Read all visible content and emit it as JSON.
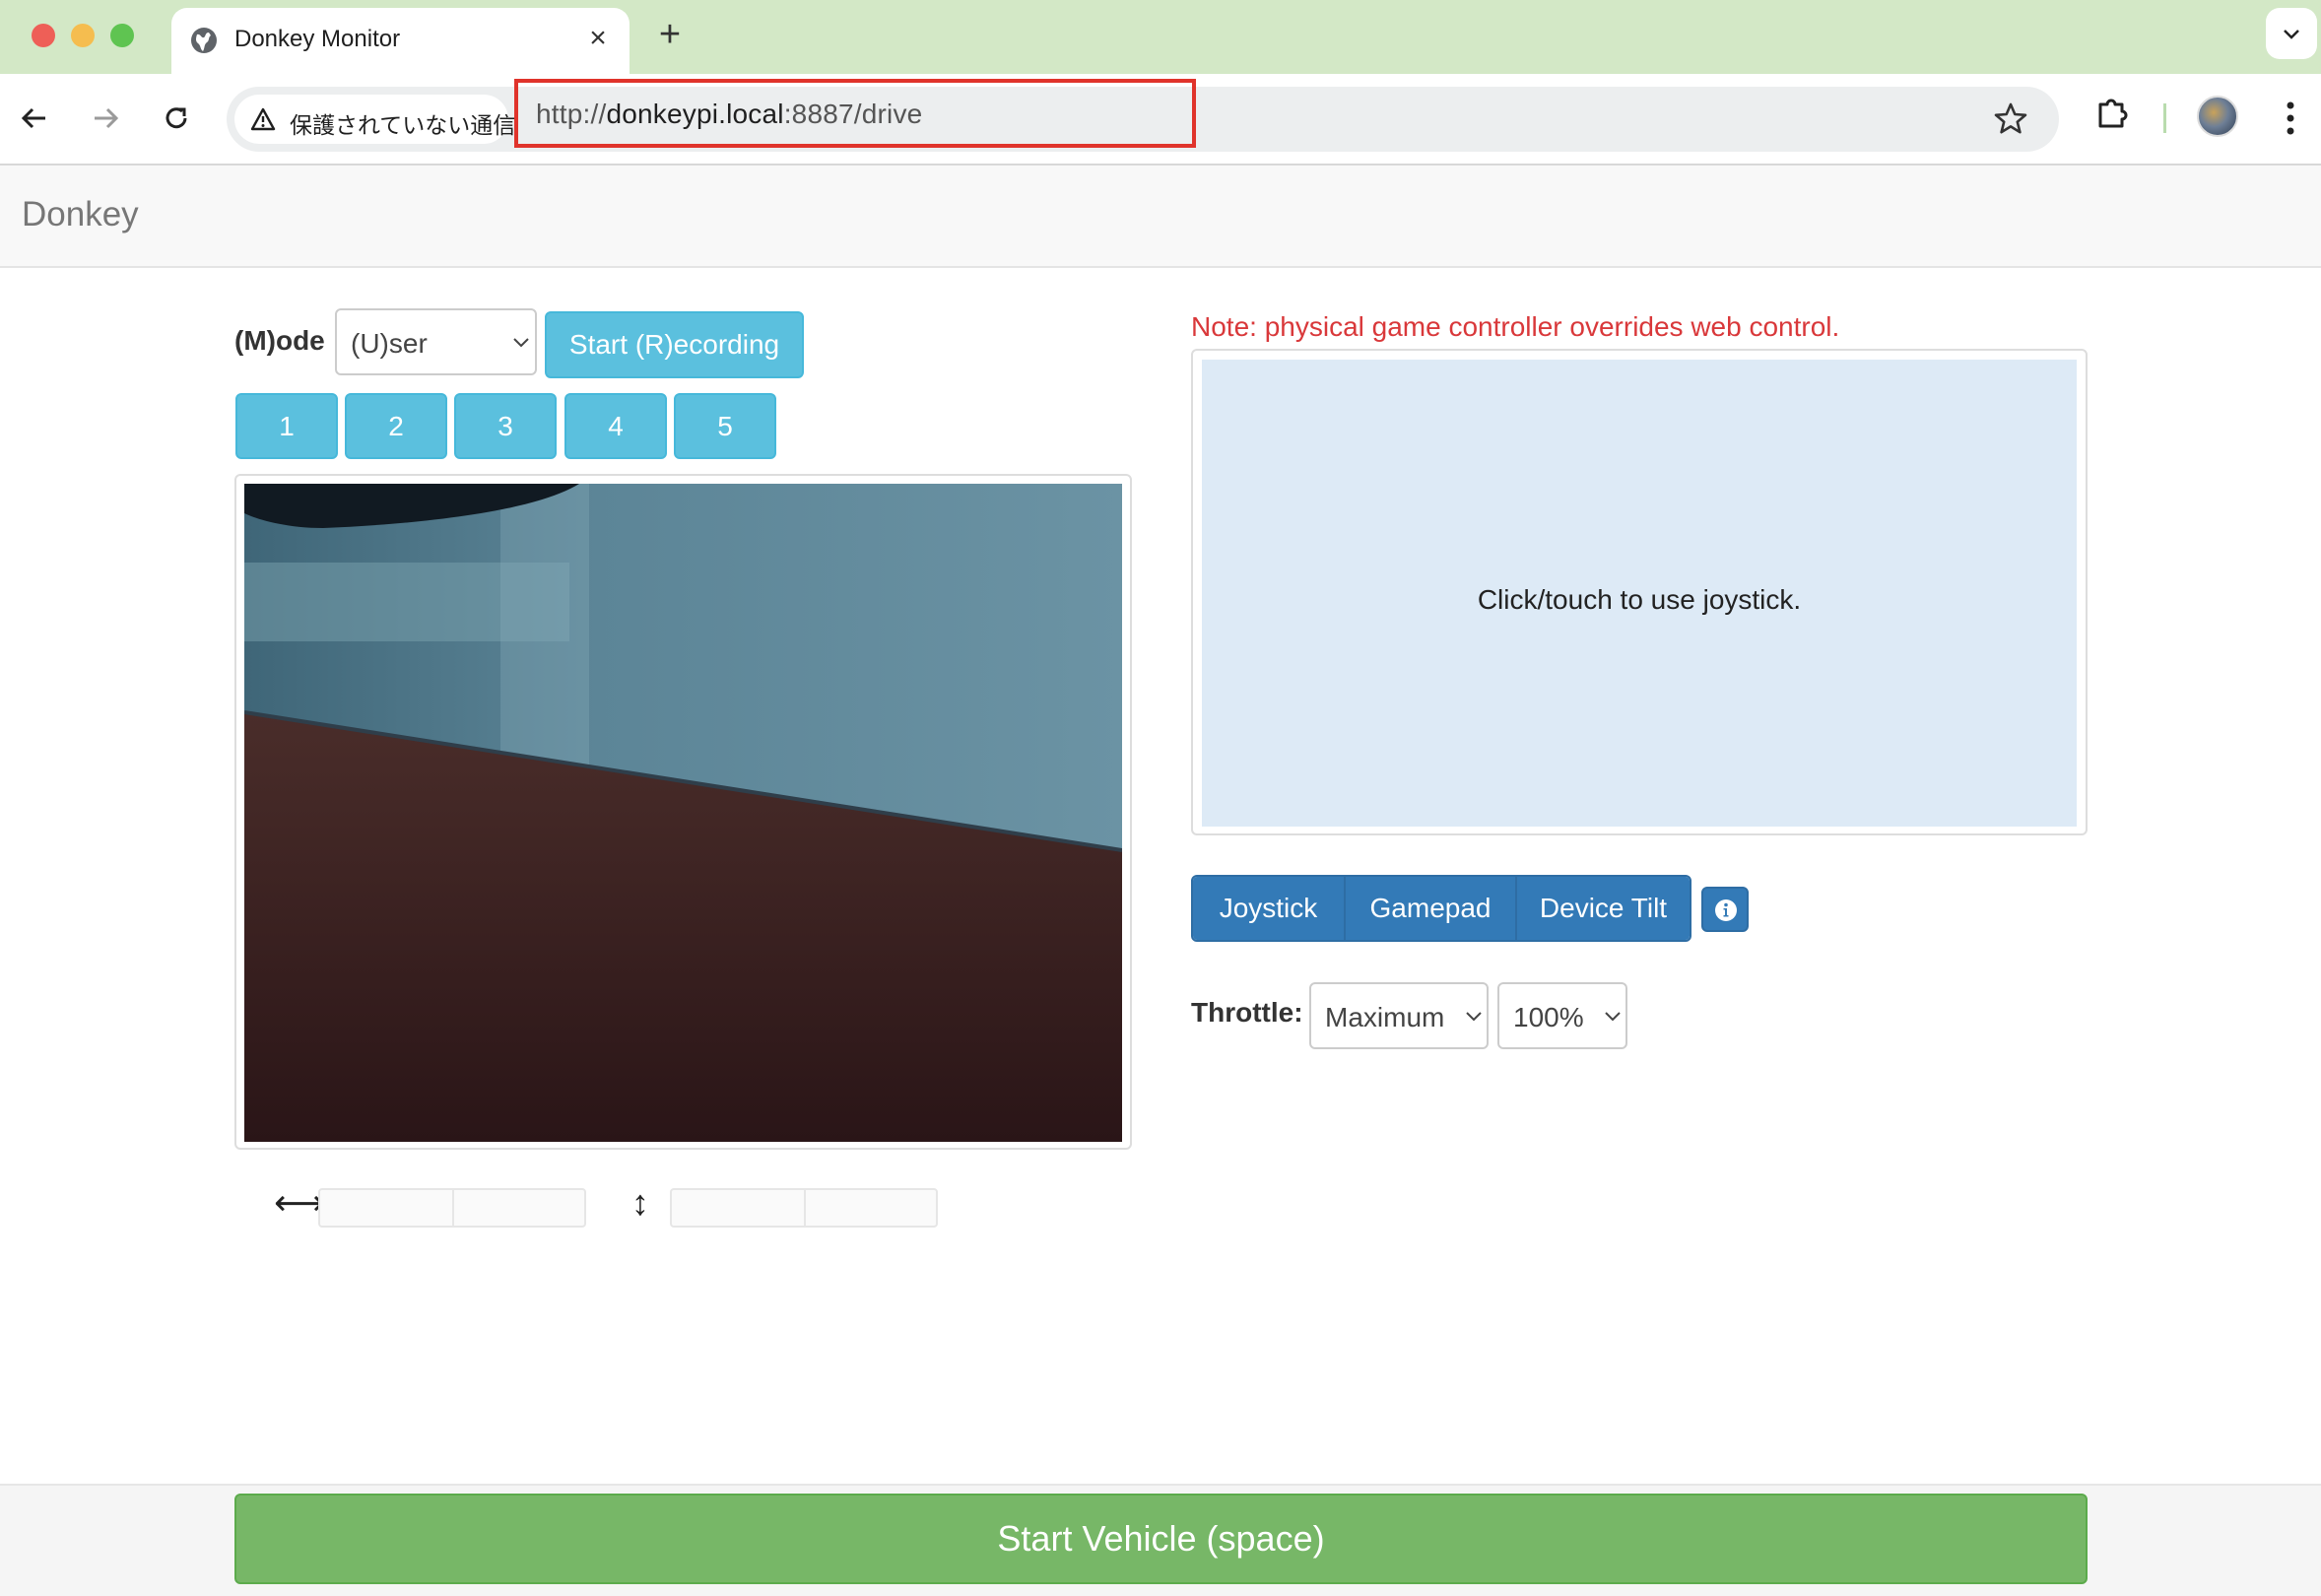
{
  "browser": {
    "tab_title": "Donkey Monitor",
    "security_label": "保護されていない通信",
    "url_scheme": "http://",
    "url_host": "donkeypi.local",
    "url_rest": ":8887/drive"
  },
  "navbar": {
    "brand": "Donkey"
  },
  "controls": {
    "mode_label": "(M)ode",
    "mode_value": "(U)ser",
    "record_button": "Start (R)ecording",
    "number_buttons": [
      "1",
      "2",
      "3",
      "4",
      "5"
    ]
  },
  "joystick": {
    "note": "Note: physical game controller overrides web control.",
    "area_text": "Click/touch to use joystick.",
    "tabs": [
      "Joystick",
      "Gamepad",
      "Device Tilt"
    ],
    "info_icon": "info-circle-icon"
  },
  "throttle": {
    "label": "Throttle:",
    "mode_value": "Maximum",
    "percent_value": "100%"
  },
  "footer": {
    "start_button": "Start Vehicle (space)"
  },
  "colors": {
    "tabbar_bg": "#d3e8c6",
    "info_light": "#5bc0de",
    "primary": "#337ab7",
    "success": "#77b767",
    "warning_text": "#d9383a",
    "url_highlight": "#e0332b",
    "joystick_bg": "#ddeaf6"
  }
}
